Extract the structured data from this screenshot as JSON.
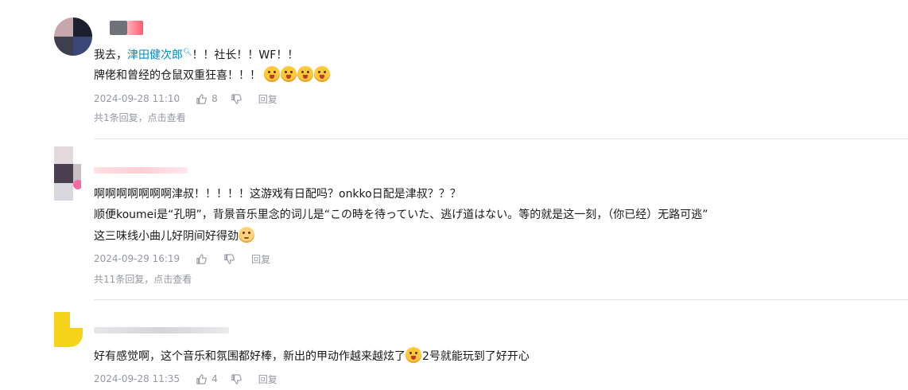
{
  "comments": [
    {
      "line1_prefix": "我去，",
      "mention": "津田健次郎",
      "line1_suffix": "！！社长！！WF！！",
      "line2": "牌佬和曾经的仓鼠双重狂喜！！！",
      "time": "2024-09-28 11:10",
      "likes": "8",
      "reply_label": "回复",
      "sub_reply": "共1条回复，",
      "view_label": "点击查看"
    },
    {
      "line1": "啊啊啊啊啊啊啊津叔！！！！！这游戏有日配吗？onkko日配是津叔？？？",
      "line2": "顺便koumei是“孔明”，背景音乐里念的词儿是“この時を待っていた、逃げ道はない。等的就是这一刻，（你已经）无路可逃”",
      "line3": "这三味线小曲儿好阴间好得劲",
      "time": "2024-09-29 16:19",
      "reply_label": "回复",
      "sub_reply": "共11条回复，",
      "view_label": "点击查看"
    },
    {
      "line1_prefix": "好有感觉啊，这个音乐和氛围都好棒，新出的甲动作越来越炫了",
      "line1_suffix": "2号就能玩到了好开心",
      "time": "2024-09-28 11:35",
      "likes": "4",
      "reply_label": "回复"
    }
  ],
  "icons": {
    "like": "thumbs-up-icon",
    "dislike": "thumbs-down-icon",
    "emoji": "emoji-face-icon",
    "search": "search-icon"
  },
  "colors": {
    "mention": "#008ac5",
    "meta": "#9499a0",
    "divider": "#e3e5e7"
  }
}
